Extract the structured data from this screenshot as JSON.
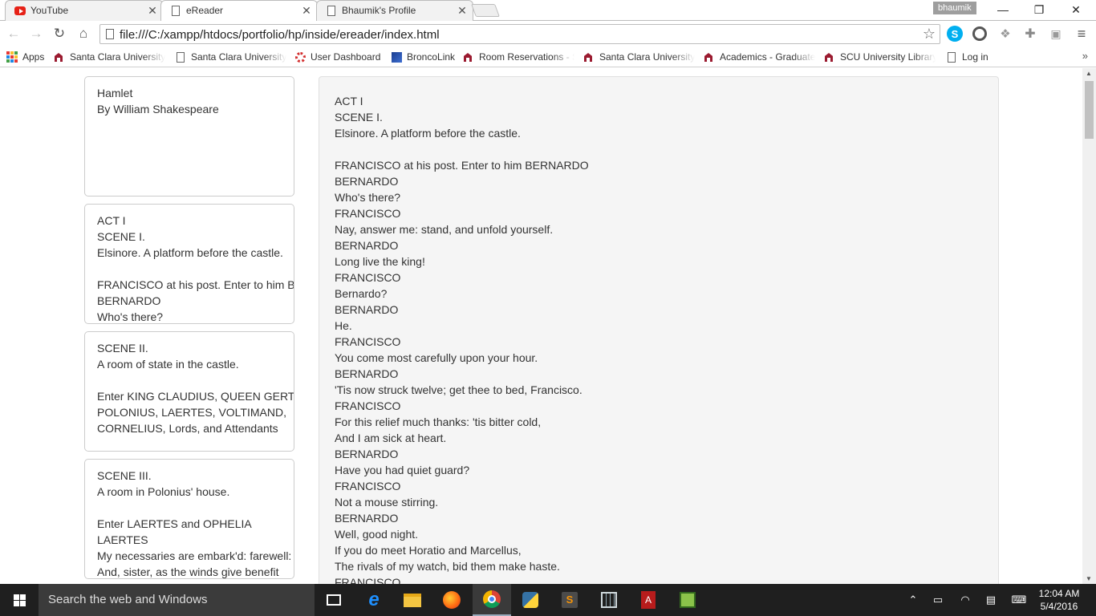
{
  "browser": {
    "tabs": [
      {
        "title": "YouTube",
        "icon": "youtube-icon",
        "active": false
      },
      {
        "title": "eReader",
        "icon": "page-icon",
        "active": true
      },
      {
        "title": "Bhaumik's Profile",
        "icon": "page-icon",
        "active": false
      }
    ],
    "profile_name": "bhaumik",
    "url": "file:///C:/xampp/htdocs/portfolio/hp/inside/ereader/index.html"
  },
  "bookmarks": [
    {
      "label": "Apps",
      "icon": "apps-grid-icon"
    },
    {
      "label": "Santa Clara University",
      "icon": "scu-icon"
    },
    {
      "label": "Santa Clara University",
      "icon": "page-icon"
    },
    {
      "label": "User Dashboard",
      "icon": "ring-icon"
    },
    {
      "label": "BroncoLink",
      "icon": "broncolink-icon"
    },
    {
      "label": "Room Reservations - S",
      "icon": "scu-icon"
    },
    {
      "label": "Santa Clara University",
      "icon": "scu-icon"
    },
    {
      "label": "Academics - Graduate",
      "icon": "scu-icon"
    },
    {
      "label": "SCU University Library",
      "icon": "scu-icon"
    },
    {
      "label": "Log in",
      "icon": "page-icon"
    }
  ],
  "sidebar": {
    "cards": [
      {
        "lines": [
          "Hamlet",
          "By William Shakespeare"
        ]
      },
      {
        "lines": [
          "ACT I",
          "SCENE I.",
          "Elsinore. A platform before the castle.",
          "",
          "FRANCISCO at his post. Enter to him BERNARDO",
          "BERNARDO",
          "Who's there?"
        ]
      },
      {
        "lines": [
          "SCENE II.",
          "A room of state in the castle.",
          "",
          "Enter KING CLAUDIUS, QUEEN GERTRUDE, HAMLET,",
          "POLONIUS, LAERTES, VOLTIMAND,",
          "CORNELIUS, Lords, and Attendants"
        ]
      },
      {
        "lines": [
          "SCENE III.",
          "A room in Polonius' house.",
          "",
          "Enter LAERTES and OPHELIA",
          "LAERTES",
          "My necessaries are embark'd: farewell:",
          "And, sister, as the winds give benefit"
        ]
      }
    ]
  },
  "reader": {
    "lines": [
      "ACT I",
      "SCENE I.",
      "Elsinore. A platform before the castle.",
      "",
      "FRANCISCO at his post. Enter to him BERNARDO",
      "BERNARDO",
      "Who's there?",
      "FRANCISCO",
      "Nay, answer me: stand, and unfold yourself.",
      "BERNARDO",
      "Long live the king!",
      "FRANCISCO",
      "Bernardo?",
      "BERNARDO",
      "He.",
      "FRANCISCO",
      "You come most carefully upon your hour.",
      "BERNARDO",
      "'Tis now struck twelve; get thee to bed, Francisco.",
      "FRANCISCO",
      "For this relief much thanks: 'tis bitter cold,",
      "And I am sick at heart.",
      "BERNARDO",
      "Have you had quiet guard?",
      "FRANCISCO",
      "Not a mouse stirring.",
      "BERNARDO",
      "Well, good night.",
      "If you do meet Horatio and Marcellus,",
      "The rivals of my watch, bid them make haste.",
      "FRANCISCO"
    ]
  },
  "taskbar": {
    "search_placeholder": "Search the web and Windows",
    "time": "12:04 AM",
    "date": "5/4/2016"
  }
}
